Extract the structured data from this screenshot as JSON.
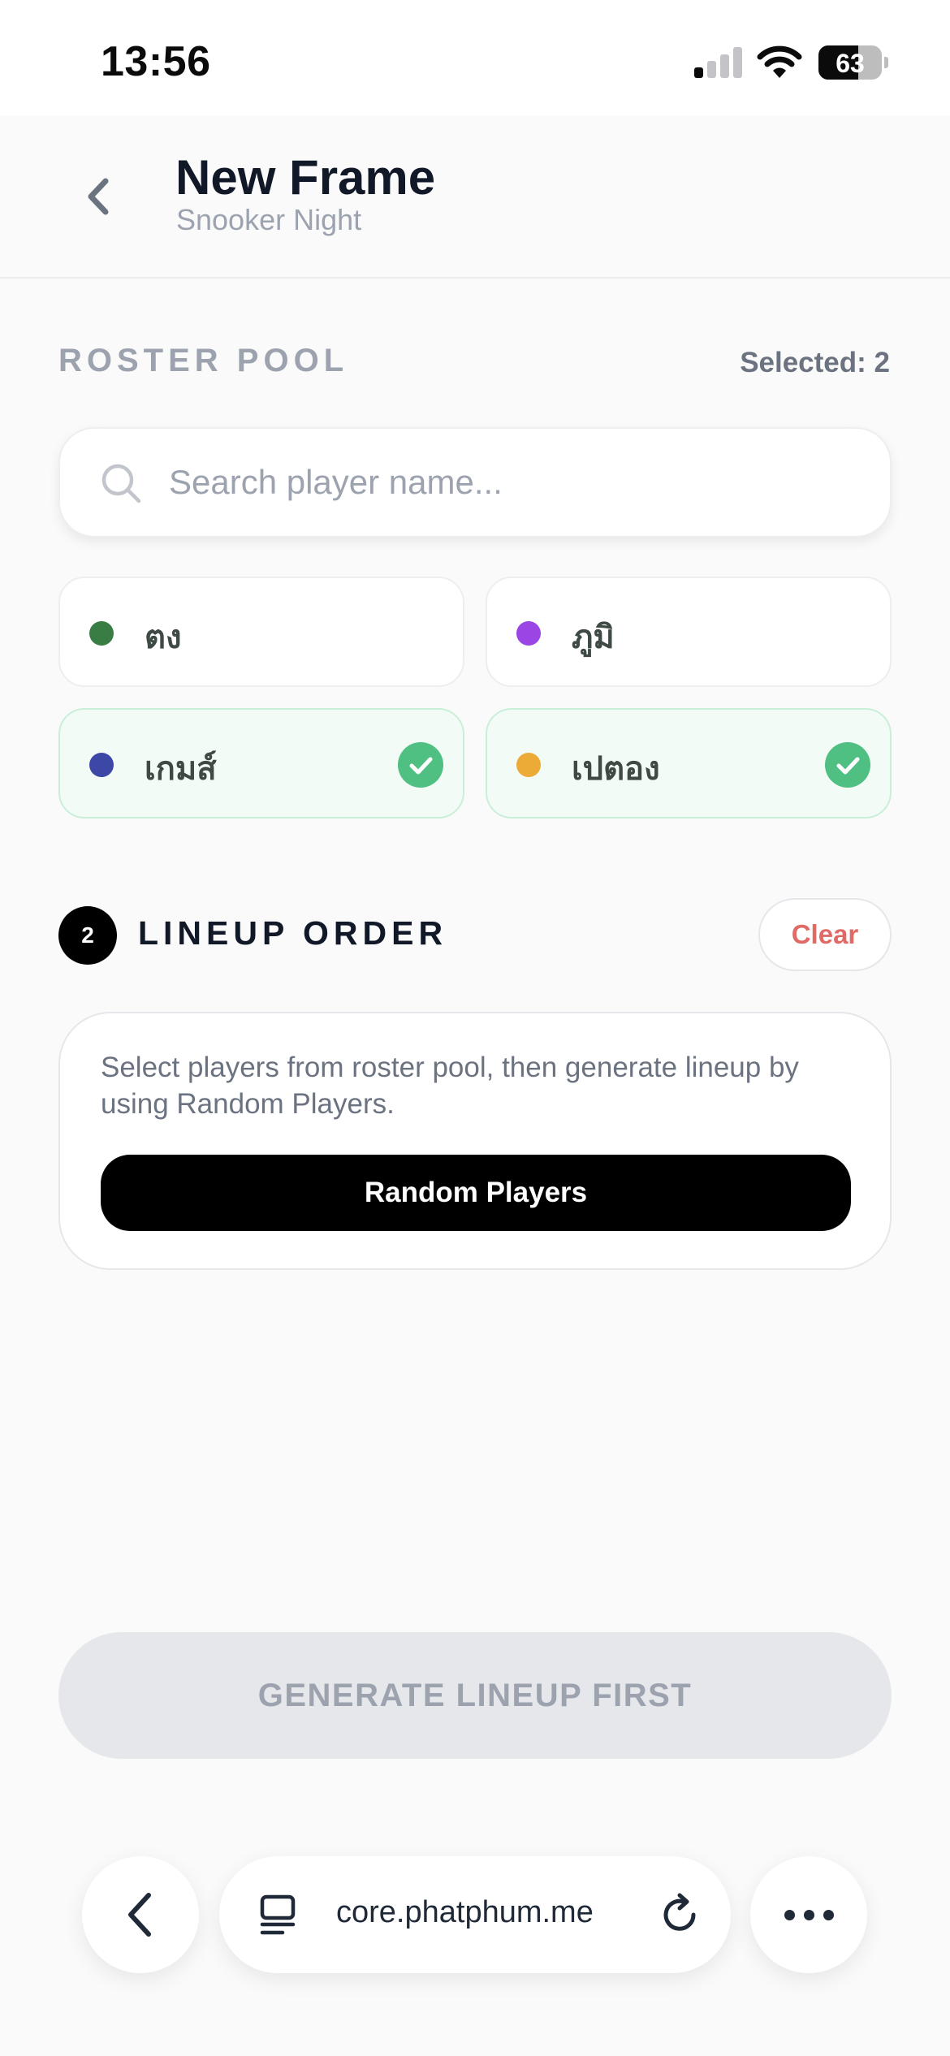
{
  "status_bar": {
    "time": "13:56",
    "battery_level": "63",
    "signal_icon": "signal-bars-icon",
    "wifi_icon": "wifi-icon"
  },
  "header": {
    "back_icon": "chevron-left-icon",
    "title": "New Frame",
    "subtitle": "Snooker Night"
  },
  "roster": {
    "section_label": "ROSTER POOL",
    "selected_text": "Selected: 2",
    "search_placeholder": "Search player name...",
    "search_value": "",
    "players": [
      {
        "name": "ตง",
        "color": "#3a7d44",
        "selected": false
      },
      {
        "name": "ภูมิ",
        "color": "#9b45e4",
        "selected": false
      },
      {
        "name": "เกมส์",
        "color": "#3d47a6",
        "selected": true
      },
      {
        "name": "เปตอง",
        "color": "#ecaa37",
        "selected": true
      }
    ]
  },
  "lineup": {
    "step_number": "2",
    "title": "LINEUP ORDER",
    "clear_label": "Clear",
    "hint": "Select players from roster pool, then generate lineup by using Random Players.",
    "random_label": "Random Players"
  },
  "footer": {
    "generate_label": "GENERATE LINEUP FIRST"
  },
  "browser": {
    "url_text": "core.phatphum.me",
    "back_icon": "chevron-left-icon",
    "tabs_icon": "tabs-icon",
    "reload_icon": "reload-icon",
    "more_icon": "more-dots-icon"
  },
  "colors": {
    "accent": "#000000",
    "selected_check": "#4fbf82",
    "selected_bg": "#f3fbf6",
    "danger": "#e06a66",
    "muted": "#9ca3af"
  }
}
